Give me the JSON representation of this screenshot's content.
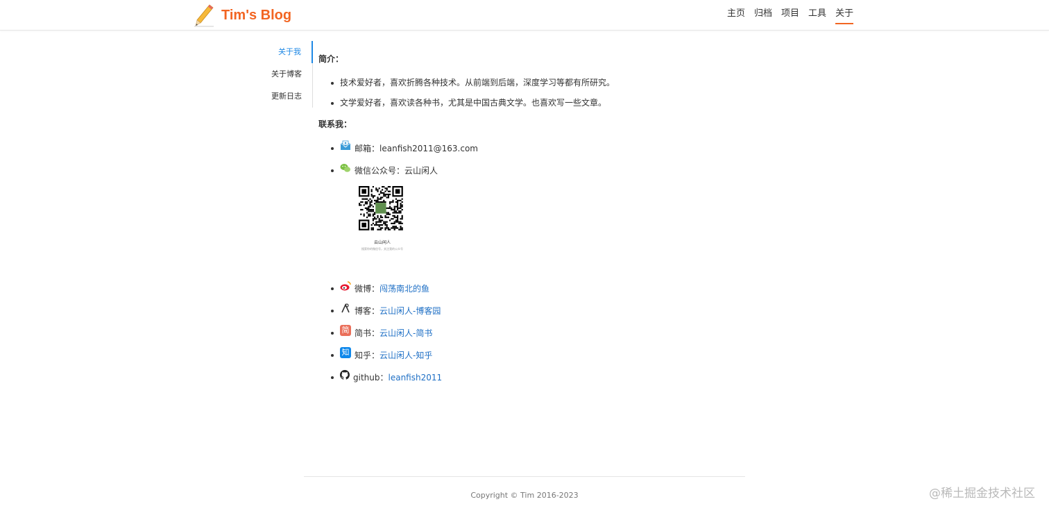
{
  "header": {
    "title": "Tim's Blog",
    "nav": [
      "主页",
      "归档",
      "项目",
      "工具",
      "关于"
    ],
    "active_color": "#f26522"
  },
  "sidebar": {
    "items": [
      "关于我",
      "关于博客",
      "更新日志"
    ],
    "active_color": "#1e88e5"
  },
  "content": {
    "intro_title": "简介：",
    "intro": [
      "技术爱好者，喜欢折腾各种技术。从前端到后端，深度学习等都有所研究。",
      "文学爱好者，喜欢读各种书，尤其是中国古典文学。也喜欢写一些文章。"
    ],
    "contact_title": "联系我：",
    "email": {
      "icon": "mail-icon",
      "label": "邮箱：",
      "value": "leanfish2011@163.com"
    },
    "wechat": {
      "icon": "wechat-icon",
      "label": "微信公众号：",
      "value": "云山闲人"
    },
    "qr": {
      "caption": "云山闲人",
      "subcaption": "搜索你的微信号，关注我的公众号"
    },
    "weibo": {
      "icon": "weibo-icon",
      "label": "微博：",
      "link": "闯荡南北的鱼"
    },
    "cnblogs": {
      "icon": "cnblogs-icon",
      "label": "博客：",
      "link": "云山闲人-博客园"
    },
    "jianshu": {
      "icon": "jianshu-icon",
      "label": "简书：",
      "link": "云山闲人-简书",
      "icon_char": "简"
    },
    "zhihu": {
      "icon": "zhihu-icon",
      "label": "知乎：",
      "link": "云山闲人-知乎",
      "icon_char": "知"
    },
    "github": {
      "icon": "github-icon",
      "label": "github：",
      "link": "leanfish2011"
    }
  },
  "footer": {
    "copyright": "Copyright © Tim 2016-2023"
  },
  "watermark": "@稀土掘金技术社区",
  "link_color": "#1e6fc5"
}
